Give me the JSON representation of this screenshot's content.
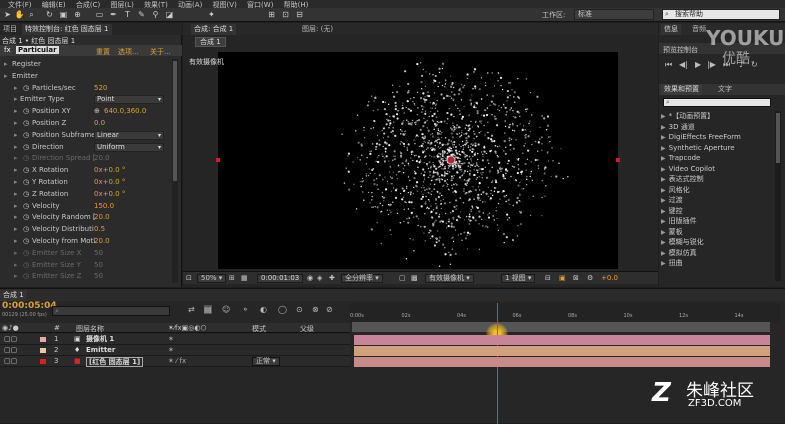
{
  "menubar": {
    "items": [
      "文件(F)",
      "编辑(E)",
      "合成(C)",
      "图层(L)",
      "效果(T)",
      "动画(A)",
      "视图(V)",
      "窗口(W)",
      "帮助(H)"
    ]
  },
  "toolbar": {
    "workspace_label": "工作区:",
    "workspace_value": "标准",
    "search_placeholder": "搜索帮助"
  },
  "effects_controls": {
    "tabs": [
      "项目",
      "特效控制台: 红色 固态层 1"
    ],
    "layer_path": "合成 1 • 红色 固态层 1",
    "effect_name": "Particular",
    "effect_links": [
      "重置",
      "选项...",
      "关于..."
    ],
    "rows": [
      {
        "label": "Register",
        "value": "",
        "indent": 0,
        "dim": false
      },
      {
        "label": "Emitter",
        "value": "",
        "indent": 0,
        "dim": false
      },
      {
        "label": "Particles/sec",
        "value": "520",
        "indent": 2,
        "dim": false
      },
      {
        "label": "Emitter Type",
        "value": "Point",
        "indent": 1,
        "dim": false,
        "dropdown": true
      },
      {
        "label": "Position XY",
        "value": "640.0,360.0",
        "indent": 2,
        "dim": false
      },
      {
        "label": "Position Z",
        "value": "0.0",
        "indent": 2,
        "dim": false
      },
      {
        "label": "Position Subframe",
        "value": "Linear",
        "indent": 2,
        "dim": false,
        "dropdown": true
      },
      {
        "label": "Direction",
        "value": "Uniform",
        "indent": 2,
        "dim": false,
        "dropdown": true
      },
      {
        "label": "Direction Spread [",
        "value": "20.0",
        "indent": 2,
        "dim": true
      },
      {
        "label": "X Rotation",
        "value": "0x+0.0 °",
        "indent": 2,
        "dim": false
      },
      {
        "label": "Y Rotation",
        "value": "0x+0.0 °",
        "indent": 2,
        "dim": false
      },
      {
        "label": "Z Rotation",
        "value": "0x+0.0 °",
        "indent": 2,
        "dim": false
      },
      {
        "label": "Velocity",
        "value": "150.0",
        "indent": 2,
        "dim": false
      },
      {
        "label": "Velocity Random [",
        "value": "20.0",
        "indent": 2,
        "dim": false
      },
      {
        "label": "Velocity Distributi",
        "value": "0.5",
        "indent": 2,
        "dim": false
      },
      {
        "label": "Velocity from Moti",
        "value": "20.0",
        "indent": 2,
        "dim": false
      },
      {
        "label": "Emitter Size X",
        "value": "50",
        "indent": 2,
        "dim": true
      },
      {
        "label": "Emitter Size Y",
        "value": "50",
        "indent": 2,
        "dim": true
      },
      {
        "label": "Emitter Size Z",
        "value": "50",
        "indent": 2,
        "dim": true
      }
    ]
  },
  "composition": {
    "tabs": [
      "合成: 合成 1",
      "图层: (无)"
    ],
    "subtab": "合成 1",
    "camera_label": "有效摄像机",
    "footer": {
      "zoom": "50%",
      "timecode": "0:00:01:03",
      "resolution": "全分辨率",
      "camera": "有效摄像机",
      "views": "1 视图",
      "exposure": "+0.0"
    }
  },
  "right": {
    "info_tabs": [
      "信息",
      "音频"
    ],
    "preview_title": "预览控制台",
    "effects_tabs": [
      "效果和预置",
      "文字"
    ],
    "effects_search": "",
    "categories": [
      "*【动画预置】",
      "3D 通道",
      "DigiEffects FreeForm",
      "Synthetic Aperture",
      "Trapcode",
      "Video Copilot",
      "表达式控制",
      "风格化",
      "过渡",
      "键控",
      "旧版插件",
      "蒙板",
      "模糊与锐化",
      "模拟仿真",
      "扭曲"
    ]
  },
  "timeline": {
    "tab": "合成 1",
    "timecode": "0:00:05:04",
    "timecode_sub": "00129 (25.00 fps)",
    "columns": {
      "source": "图层名称",
      "mode": "模式",
      "parent": "父级"
    },
    "layers": [
      {
        "num": "1",
        "name": "摄像机 1",
        "color": "#e9a9a9"
      },
      {
        "num": "2",
        "name": "Emitter",
        "color": "#e8c7a8"
      },
      {
        "num": "3",
        "name": "[红色 固态层 1]",
        "color": "#d22222",
        "mode": "正常"
      }
    ],
    "ruler": [
      "0:00s",
      "02s",
      "04s",
      "06s",
      "08s",
      "10s",
      "12s",
      "14s"
    ],
    "playhead_seconds": 5.16
  },
  "watermarks": {
    "youku": "YOUKU",
    "youku_cn": "优酷",
    "zf_cn": "朱峰社区",
    "zf_en": "ZF3D.COM"
  }
}
